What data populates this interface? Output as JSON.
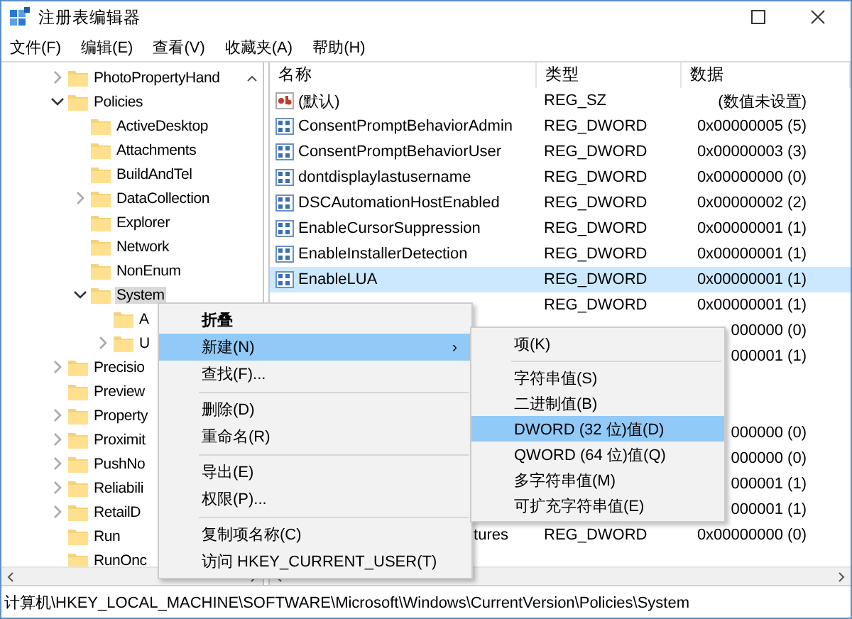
{
  "window": {
    "title": "注册表编辑器"
  },
  "menu_bar": [
    "文件(F)",
    "编辑(E)",
    "查看(V)",
    "收藏夹(A)",
    "帮助(H)"
  ],
  "tree": [
    {
      "label": "PhotoPropertyHand",
      "expandable": true,
      "expanded": false,
      "selected": false
    },
    {
      "label": "Policies",
      "expandable": true,
      "expanded": true,
      "selected": false,
      "children": [
        {
          "label": "ActiveDesktop",
          "expandable": false,
          "expanded": false,
          "selected": false
        },
        {
          "label": "Attachments",
          "expandable": false,
          "expanded": false,
          "selected": false
        },
        {
          "label": "BuildAndTel",
          "expandable": false,
          "expanded": false,
          "selected": false
        },
        {
          "label": "DataCollection",
          "expandable": true,
          "expanded": false,
          "selected": false
        },
        {
          "label": "Explorer",
          "expandable": false,
          "expanded": false,
          "selected": false
        },
        {
          "label": "Network",
          "expandable": false,
          "expanded": false,
          "selected": false
        },
        {
          "label": "NonEnum",
          "expandable": false,
          "expanded": false,
          "selected": false
        },
        {
          "label": "System",
          "expandable": true,
          "expanded": true,
          "selected": true,
          "children": [
            {
              "label": "A",
              "expandable": false,
              "expanded": false,
              "selected": false
            },
            {
              "label": "U",
              "expandable": true,
              "expanded": false,
              "selected": false
            }
          ]
        }
      ]
    },
    {
      "label": "Precisio",
      "expandable": true,
      "expanded": false,
      "selected": false
    },
    {
      "label": "Preview",
      "expandable": false,
      "expanded": false,
      "selected": false
    },
    {
      "label": "Property",
      "expandable": true,
      "expanded": false,
      "selected": false
    },
    {
      "label": "Proximit",
      "expandable": true,
      "expanded": false,
      "selected": false
    },
    {
      "label": "PushNo",
      "expandable": true,
      "expanded": false,
      "selected": false
    },
    {
      "label": "Reliabili",
      "expandable": true,
      "expanded": false,
      "selected": false
    },
    {
      "label": "RetailD",
      "expandable": true,
      "expanded": false,
      "selected": false
    },
    {
      "label": "Run",
      "expandable": false,
      "expanded": false,
      "selected": false
    },
    {
      "label": "RunOnc",
      "expandable": false,
      "expanded": false,
      "selected": false
    }
  ],
  "table": {
    "columns": [
      "名称",
      "类型",
      "数据"
    ],
    "rows": [
      {
        "kind": "string",
        "name": "(默认)",
        "type": "REG_SZ",
        "data": "(数值未设置)",
        "selected": false
      },
      {
        "kind": "dword",
        "name": "ConsentPromptBehaviorAdmin",
        "type": "REG_DWORD",
        "data": "0x00000005 (5)",
        "selected": false
      },
      {
        "kind": "dword",
        "name": "ConsentPromptBehaviorUser",
        "type": "REG_DWORD",
        "data": "0x00000003 (3)",
        "selected": false
      },
      {
        "kind": "dword",
        "name": "dontdisplaylastusername",
        "type": "REG_DWORD",
        "data": "0x00000000 (0)",
        "selected": false
      },
      {
        "kind": "dword",
        "name": "DSCAutomationHostEnabled",
        "type": "REG_DWORD",
        "data": "0x00000002 (2)",
        "selected": false
      },
      {
        "kind": "dword",
        "name": "EnableCursorSuppression",
        "type": "REG_DWORD",
        "data": "0x00000001 (1)",
        "selected": false
      },
      {
        "kind": "dword",
        "name": "EnableInstallerDetection",
        "type": "REG_DWORD",
        "data": "0x00000001 (1)",
        "selected": false
      },
      {
        "kind": "dword",
        "name": "EnableLUA",
        "type": "REG_DWORD",
        "data": "0x00000001 (1)",
        "selected": true
      },
      {
        "kind": "none",
        "type": "REG_DWORD",
        "data": "0x00000001 (1)",
        "selected": false
      },
      {
        "kind": "none",
        "data": "000000 (0)",
        "selected": false
      },
      {
        "kind": "none",
        "data": "000001 (1)",
        "selected": false
      },
      {
        "kind": "none",
        "selected": false
      },
      {
        "kind": "none",
        "selected": false
      },
      {
        "kind": "none",
        "data": "000000 (0)",
        "selected": false
      },
      {
        "kind": "none",
        "data": "000000 (0)",
        "selected": false
      },
      {
        "kind": "none",
        "data": "000001 (1)",
        "selected": false
      },
      {
        "kind": "none",
        "data": "000001 (1)",
        "selected": false
      },
      {
        "kind": "none",
        "name": "tures",
        "type": "REG_DWORD",
        "data": "0x00000000 (0)",
        "selected": false
      }
    ]
  },
  "context_menu": [
    {
      "kind": "item",
      "label": "折叠",
      "bold": true,
      "selected": false
    },
    {
      "kind": "item",
      "label": "新建(N)",
      "bold": false,
      "selected": true,
      "arrow": "›"
    },
    {
      "kind": "item",
      "label": "查找(F)...",
      "bold": false,
      "selected": false
    },
    {
      "kind": "separator"
    },
    {
      "kind": "item",
      "label": "删除(D)",
      "bold": false,
      "selected": false
    },
    {
      "kind": "item",
      "label": "重命名(R)",
      "bold": false,
      "selected": false
    },
    {
      "kind": "separator"
    },
    {
      "kind": "item",
      "label": "导出(E)",
      "bold": false,
      "selected": false
    },
    {
      "kind": "item",
      "label": "权限(P)...",
      "bold": false,
      "selected": false
    },
    {
      "kind": "separator"
    },
    {
      "kind": "item",
      "label": "复制项名称(C)",
      "bold": false,
      "selected": false
    },
    {
      "kind": "item",
      "label": "访问 HKEY_CURRENT_USER(T)",
      "bold": false,
      "selected": false
    }
  ],
  "submenu": [
    {
      "kind": "item",
      "label": "项(K)",
      "selected": false
    },
    {
      "kind": "separator"
    },
    {
      "kind": "item",
      "label": "字符串值(S)",
      "selected": false
    },
    {
      "kind": "item",
      "label": "二进制值(B)",
      "selected": false
    },
    {
      "kind": "item",
      "label": "DWORD (32 位)值(D)",
      "selected": true
    },
    {
      "kind": "item",
      "label": "QWORD (64 位)值(Q)",
      "selected": false
    },
    {
      "kind": "item",
      "label": "多字符串值(M)",
      "selected": false
    },
    {
      "kind": "item",
      "label": "可扩充字符串值(E)",
      "selected": false
    }
  ],
  "status_bar": "计算机\\HKEY_LOCAL_MACHINE\\SOFTWARE\\Microsoft\\Windows\\CurrentVersion\\Policies\\System"
}
